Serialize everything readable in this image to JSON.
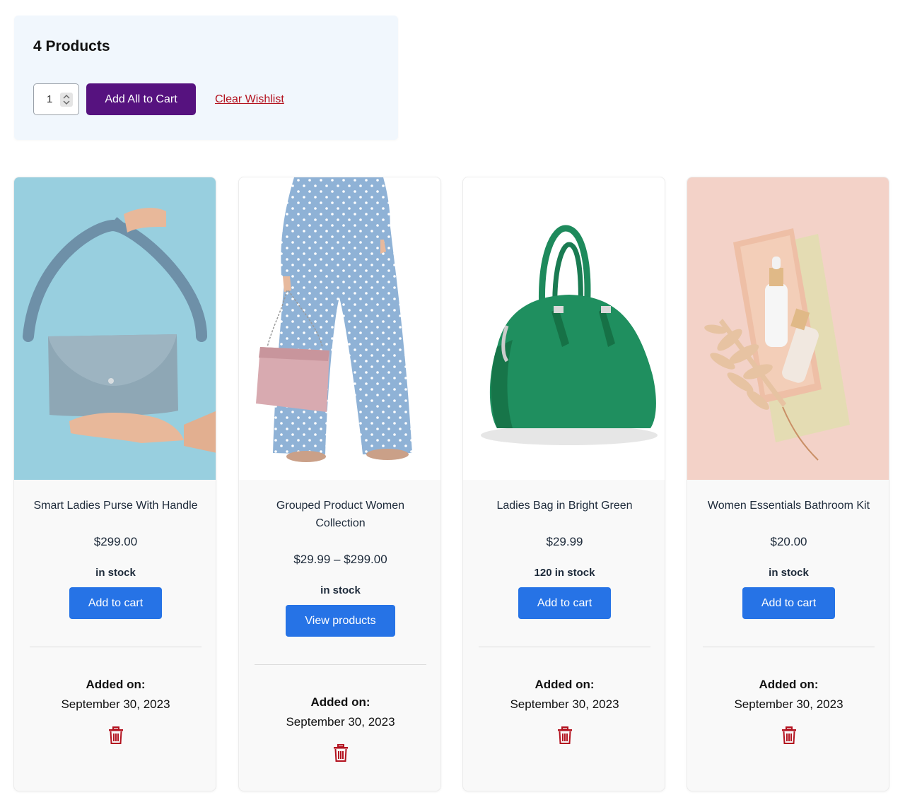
{
  "summary": {
    "title": "4 Products",
    "quantity": "1",
    "add_all_label": "Add All to Cart",
    "clear_label": "Clear Wishlist"
  },
  "products": [
    {
      "name": "Smart Ladies Purse With Handle",
      "price": "$299.00",
      "stock": "in stock",
      "button": "Add to cart",
      "added_label": "Added on:",
      "added_date": "September 30, 2023",
      "image": "blue-purse-photo"
    },
    {
      "name": "Grouped Product Women Collection",
      "price": "$29.99 – $299.00",
      "stock": "in stock",
      "button": "View products",
      "added_label": "Added on:",
      "added_date": "September 30, 2023",
      "image": "polka-dot-pants-pink-bag-photo"
    },
    {
      "name": "Ladies Bag in Bright Green",
      "price": "$29.99",
      "stock": "120 in stock",
      "button": "Add to cart",
      "added_label": "Added on:",
      "added_date": "September 30, 2023",
      "image": "green-handbag-photo"
    },
    {
      "name": "Women Essentials Bathroom Kit",
      "price": "$20.00",
      "stock": "in stock",
      "button": "Add to cart",
      "added_label": "Added on:",
      "added_date": "September 30, 2023",
      "image": "bathroom-kit-photo"
    }
  ],
  "colors": {
    "primary_button": "#2673e6",
    "add_all_button": "#56127f",
    "danger": "#b3121f",
    "summary_bg": "#f1f7fd"
  },
  "icons": [
    "trash-icon",
    "spinner-arrows-icon"
  ]
}
